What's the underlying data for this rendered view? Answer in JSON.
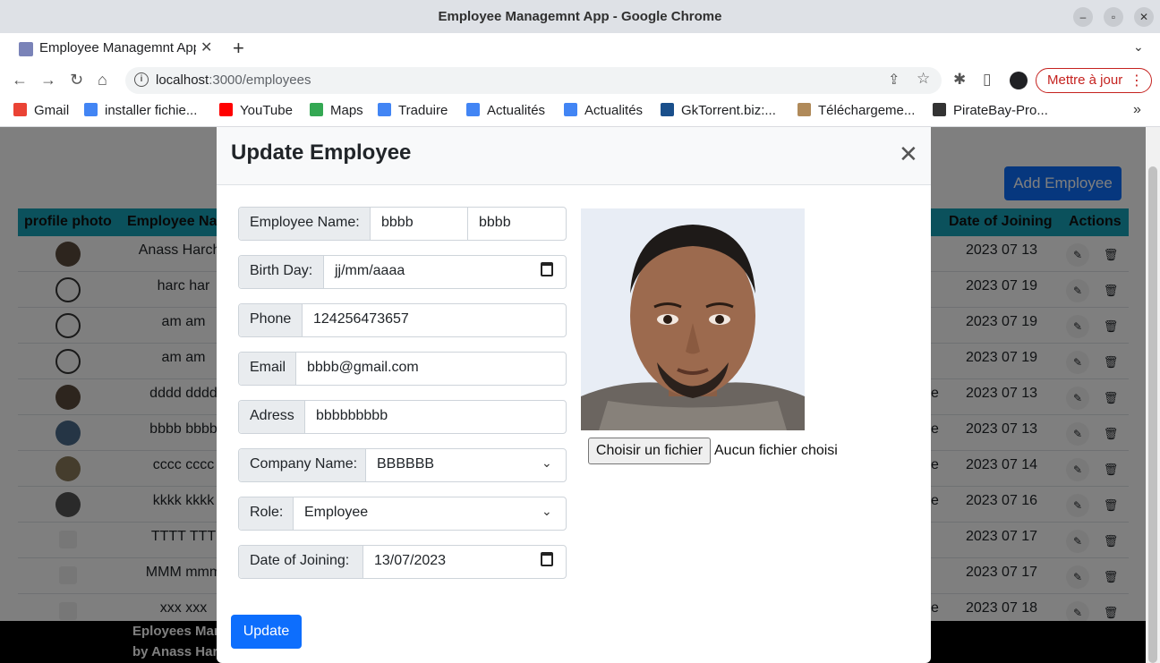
{
  "window": {
    "title": "Employee Managemnt App - Google Chrome",
    "min": "–",
    "max": "▫",
    "close": "✕"
  },
  "tab": {
    "title": "Employee Managemnt App",
    "close": "✕",
    "new": "+",
    "menu": "⌄"
  },
  "nav": {
    "back": "←",
    "forward": "→",
    "reload": "↻",
    "home": "⌂"
  },
  "address": {
    "host": "localhost",
    "path": ":3000/employees",
    "info": "i",
    "share": "⇪",
    "star": "☆"
  },
  "toolbar": {
    "extensions": "✱",
    "sidepanel": "▯",
    "update_label": "Mettre à jour",
    "menu": "⋮"
  },
  "bookmarks": [
    {
      "label": "Gmail",
      "color": "#ea4335"
    },
    {
      "label": "installer fichie...",
      "color": "#4285f4"
    },
    {
      "label": "YouTube",
      "color": "#ff0000"
    },
    {
      "label": "Maps",
      "color": "#34a853"
    },
    {
      "label": "Traduire",
      "color": "#4285f4"
    },
    {
      "label": "Actualités",
      "color": "#4285f4"
    },
    {
      "label": "Actualités",
      "color": "#4285f4"
    },
    {
      "label": "GkTorrent.biz:...",
      "color": "#1a4f8b"
    },
    {
      "label": "Téléchargeme...",
      "color": "#b08a5a"
    },
    {
      "label": "PirateBay-Pro...",
      "color": "#333333"
    }
  ],
  "bookmarks_more": "»",
  "page": {
    "add_button": "Add Employee",
    "headers": {
      "photo": "profile photo",
      "name": "Employee Na",
      "date": "Date of Joining",
      "actions": "Actions"
    },
    "rows": [
      {
        "name": "Anass Harcha",
        "extra": "",
        "date": "2023 07 13",
        "avatar": "photo"
      },
      {
        "name": "harc har",
        "extra": "",
        "date": "2023 07 19",
        "avatar": "blank"
      },
      {
        "name": "am am",
        "extra": "",
        "date": "2023 07 19",
        "avatar": "blank"
      },
      {
        "name": "am am",
        "extra": "",
        "date": "2023 07 19",
        "avatar": "blank"
      },
      {
        "name": "dddd dddd",
        "extra": "e",
        "date": "2023 07 13",
        "avatar": "photo"
      },
      {
        "name": "bbbb bbbb",
        "extra": "e",
        "date": "2023 07 13",
        "avatar": "photo"
      },
      {
        "name": "cccc cccc",
        "extra": "e",
        "date": "2023 07 14",
        "avatar": "photo"
      },
      {
        "name": "kkkk kkkk",
        "extra": "e",
        "date": "2023 07 16",
        "avatar": "photo"
      },
      {
        "name": "TTTT TTT",
        "extra": "",
        "date": "2023 07 17",
        "avatar": "broken"
      },
      {
        "name": "MMM mmm",
        "extra": "",
        "date": "2023 07 17",
        "avatar": "broken"
      },
      {
        "name": "xxx xxx",
        "extra": "e",
        "date": "2023 07 18",
        "avatar": "broken"
      }
    ],
    "edit_icon": "✎",
    "delete_icon": "🗑",
    "footer": {
      "line1": "Eployees Mar",
      "line2": "by Anass Har"
    }
  },
  "modal": {
    "title": "Update Employee",
    "close": "✕",
    "fields": {
      "name_label": "Employee Name:",
      "first_name": "bbbb",
      "last_name": "bbbb",
      "birthday_label": "Birth Day:",
      "birthday_value": "jj/mm/aaaa",
      "phone_label": "Phone",
      "phone_value": "124256473657",
      "email_label": "Email",
      "email_value": "bbbb@gmail.com",
      "address_label": "Adress",
      "address_value": "bbbbbbbbb",
      "company_label": "Company Name:",
      "company_value": "BBBBBB",
      "role_label": "Role:",
      "role_value": "Employee",
      "doj_label": "Date of Joining:",
      "doj_value": "13/07/2023"
    },
    "file_button": "Choisir un fichier",
    "file_status": "Aucun fichier choisi",
    "submit": "Update",
    "chevron": "⌄"
  },
  "colors": {
    "primary": "#0d6efd",
    "table_header": "#17a2b8",
    "update_red": "#c5221f"
  }
}
